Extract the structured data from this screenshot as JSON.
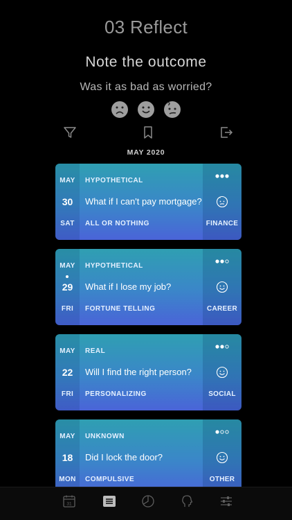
{
  "step_title": "03 Reflect",
  "headline": "Note the outcome",
  "subline": "Was it as bad as worried?",
  "faces": [
    {
      "name": "sad-face-icon"
    },
    {
      "name": "happy-face-icon"
    },
    {
      "name": "confused-face-icon"
    }
  ],
  "month_header": "MAY 2020",
  "colors": {
    "card_top": "#2f9fb2",
    "card_bottom": "#4a64d8",
    "icon_gray": "#8a8a8a"
  },
  "entries": [
    {
      "month": "MAY",
      "day": "30",
      "weekday": "SAT",
      "type": "HYPOTHETICAL",
      "question": "What if I can't pay mortgage?",
      "distortion": "ALL OR NOTHING",
      "category": "FINANCE",
      "level": 3,
      "mood_icon": "confused-face-icon",
      "marked": false
    },
    {
      "month": "MAY",
      "day": "29",
      "weekday": "FRI",
      "type": "HYPOTHETICAL",
      "question": "What if I lose my job?",
      "distortion": "FORTUNE TELLING",
      "category": "CAREER",
      "level": 2,
      "mood_icon": "happy-face-icon",
      "marked": true
    },
    {
      "month": "MAY",
      "day": "22",
      "weekday": "FRI",
      "type": "REAL",
      "question": "Will I find the right person?",
      "distortion": "PERSONALIZING",
      "category": "SOCIAL",
      "level": 2,
      "mood_icon": "happy-face-icon",
      "marked": false
    },
    {
      "month": "MAY",
      "day": "18",
      "weekday": "MON",
      "type": "UNKNOWN",
      "question": "Did I lock the door?",
      "distortion": "COMPULSIVE",
      "category": "OTHER",
      "level": 1,
      "mood_icon": "happy-face-icon",
      "marked": false
    }
  ],
  "calendar_day": "31",
  "tabs": [
    {
      "name": "tab-calendar",
      "icon": "calendar-icon",
      "active": false
    },
    {
      "name": "tab-list",
      "icon": "list-icon",
      "active": true
    },
    {
      "name": "tab-stats",
      "icon": "pie-chart-icon",
      "active": false
    },
    {
      "name": "tab-thoughts",
      "icon": "head-icon",
      "active": false
    },
    {
      "name": "tab-settings",
      "icon": "sliders-icon",
      "active": false
    }
  ]
}
